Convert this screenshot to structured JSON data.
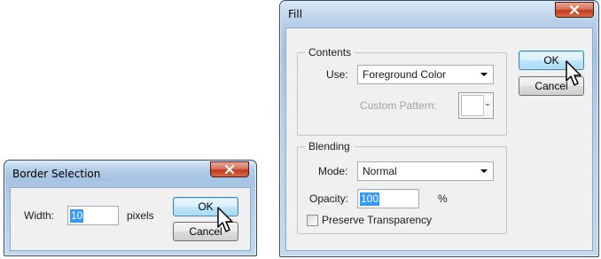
{
  "border_dialog": {
    "title": "Border Selection",
    "width_label": "Width:",
    "width_value": "10",
    "units_label": "pixels",
    "ok_label": "OK",
    "cancel_label": "Cancel"
  },
  "fill_dialog": {
    "title": "Fill",
    "contents_group_label": "Contents",
    "use_label": "Use:",
    "use_value": "Foreground Color",
    "custom_pattern_label": "Custom Pattern:",
    "blending_group_label": "Blending",
    "mode_label": "Mode:",
    "mode_value": "Normal",
    "opacity_label": "Opacity:",
    "opacity_value": "100",
    "opacity_unit": "%",
    "preserve_transparency_label": "Preserve Transparency",
    "preserve_transparency_checked": false,
    "ok_label": "OK",
    "cancel_label": "Cancel"
  },
  "icons": {
    "close": "close-icon",
    "cursor": "mouse-pointer-icon",
    "dropdown": "chevron-down-icon"
  },
  "colors": {
    "selection": "#3399ff",
    "close_button": "#c23a1f",
    "title_bar": "#a4c3e3"
  }
}
